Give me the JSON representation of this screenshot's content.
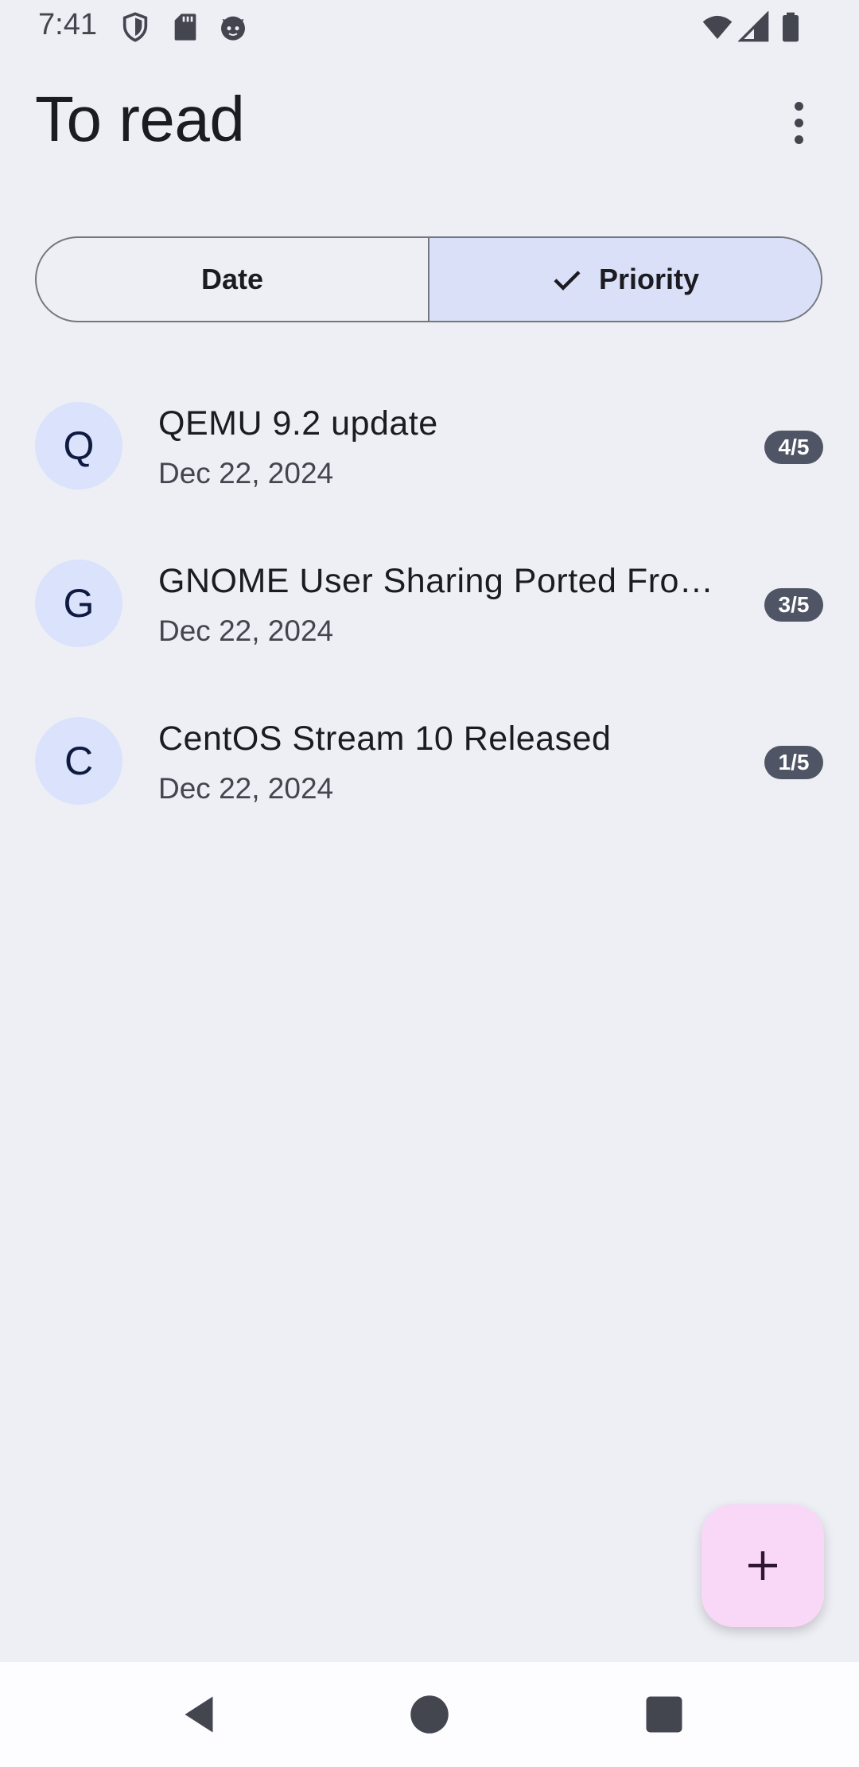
{
  "status_bar": {
    "time": "7:41",
    "icons_left": [
      "shield-icon",
      "sd-card-icon",
      "cat-icon"
    ],
    "icons_right": [
      "wifi-icon",
      "signal-icon",
      "battery-icon"
    ]
  },
  "app_bar": {
    "title": "To read",
    "menu_icon": "more-vert-icon"
  },
  "sort_toggle": {
    "options": [
      {
        "label": "Date",
        "selected": false
      },
      {
        "label": "Priority",
        "selected": true
      }
    ]
  },
  "items": [
    {
      "initial": "Q",
      "title": "QEMU 9.2 update",
      "date": "Dec 22, 2024",
      "priority": "4/5"
    },
    {
      "initial": "G",
      "title": "GNOME User Sharing Ported Fro…",
      "date": "Dec 22, 2024",
      "priority": "3/5"
    },
    {
      "initial": "C",
      "title": "CentOS Stream 10 Released",
      "date": "Dec 22, 2024",
      "priority": "1/5"
    }
  ],
  "fab": {
    "icon": "plus-icon"
  },
  "nav_bar": {
    "buttons": [
      "back-icon",
      "home-icon",
      "recents-icon"
    ]
  },
  "colors": {
    "background": "#eeeef5",
    "selected_segment": "#dae0f7",
    "avatar": "#dae2fc",
    "badge": "#505565",
    "fab": "#f9d8f7"
  }
}
